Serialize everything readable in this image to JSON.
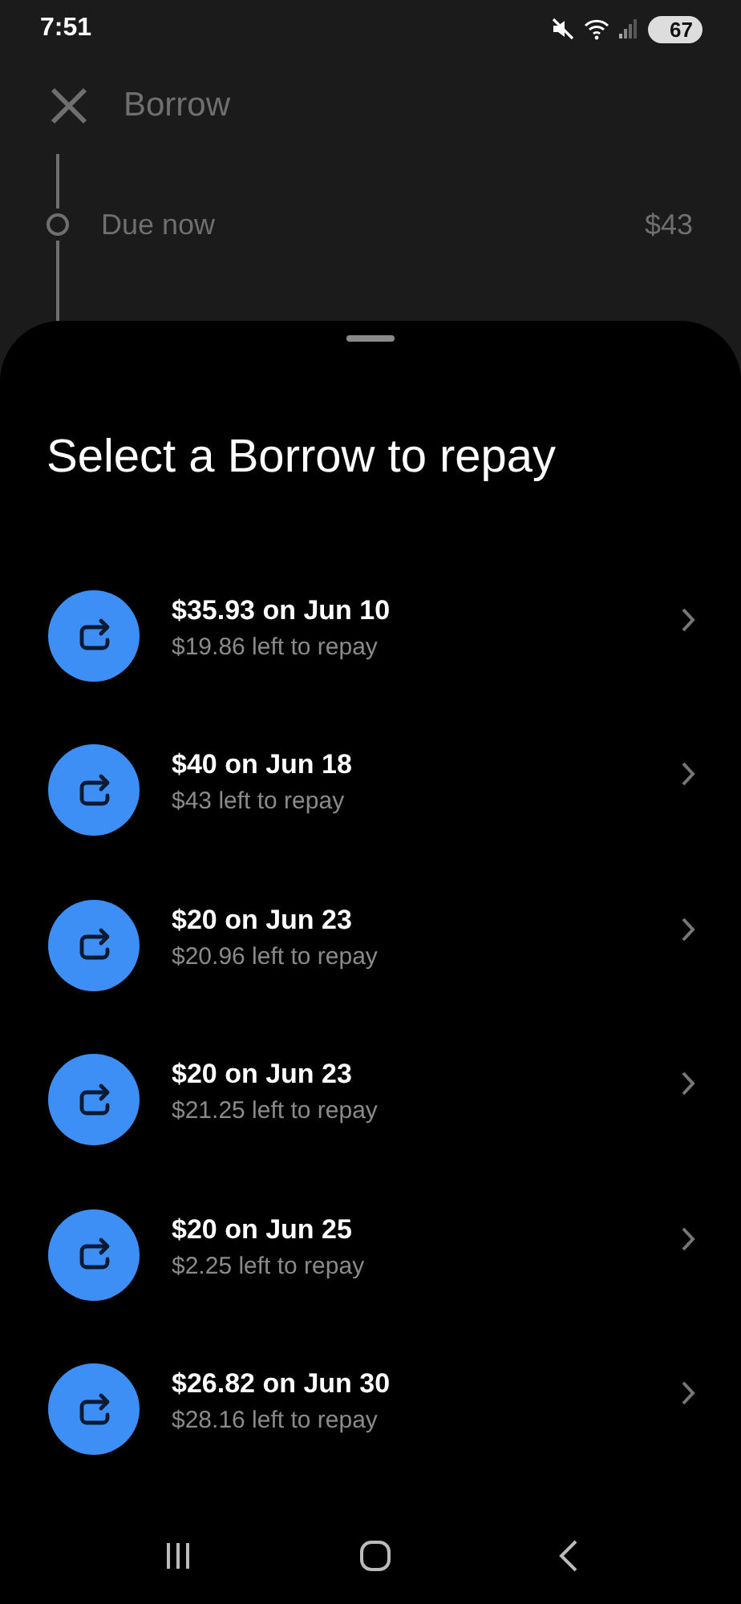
{
  "status_bar": {
    "time": "7:51",
    "battery": "67"
  },
  "header": {
    "title": "Borrow"
  },
  "timeline": {
    "label": "Due now",
    "amount": "$43"
  },
  "sheet": {
    "title": "Select a Borrow to repay",
    "items": [
      {
        "title": "$35.93 on Jun 10",
        "subtitle": "$19.86 left to repay"
      },
      {
        "title": "$40 on Jun 18",
        "subtitle": "$43 left to repay"
      },
      {
        "title": "$20 on Jun 23",
        "subtitle": "$20.96 left to repay"
      },
      {
        "title": "$20 on Jun 23",
        "subtitle": "$21.25 left to repay"
      },
      {
        "title": "$20 on Jun 25",
        "subtitle": "$2.25 left to repay"
      },
      {
        "title": "$26.82 on Jun 30",
        "subtitle": "$28.16 left to repay"
      }
    ]
  }
}
